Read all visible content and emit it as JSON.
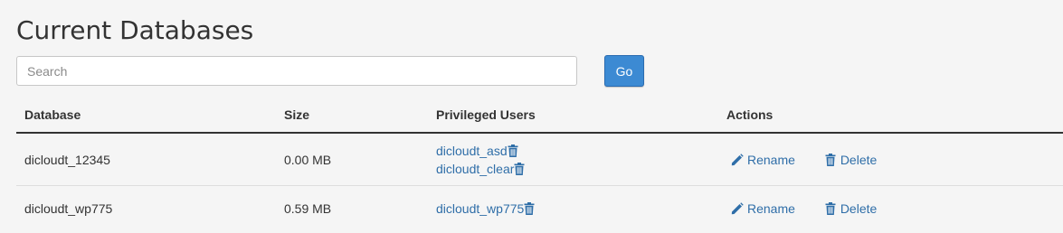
{
  "page": {
    "title": "Current Databases"
  },
  "search": {
    "placeholder": "Search",
    "value": "",
    "go_label": "Go"
  },
  "table": {
    "headers": {
      "database": "Database",
      "size": "Size",
      "users": "Privileged Users",
      "actions": "Actions"
    },
    "rows": [
      {
        "database": "dicloudt_12345",
        "size": "0.00 MB",
        "users": [
          "dicloudt_asd",
          "dicloudt_clear"
        ],
        "rename_label": "Rename",
        "delete_label": "Delete"
      },
      {
        "database": "dicloudt_wp775",
        "size": "0.59 MB",
        "users": [
          "dicloudt_wp775"
        ],
        "rename_label": "Rename",
        "delete_label": "Delete"
      }
    ]
  },
  "icons": {
    "remove_user": "trash-icon",
    "rename": "pencil-icon",
    "delete": "trash-icon"
  },
  "colors": {
    "link": "#2f6ea8",
    "button": "#3c8ad3",
    "background": "#f5f5f5"
  }
}
